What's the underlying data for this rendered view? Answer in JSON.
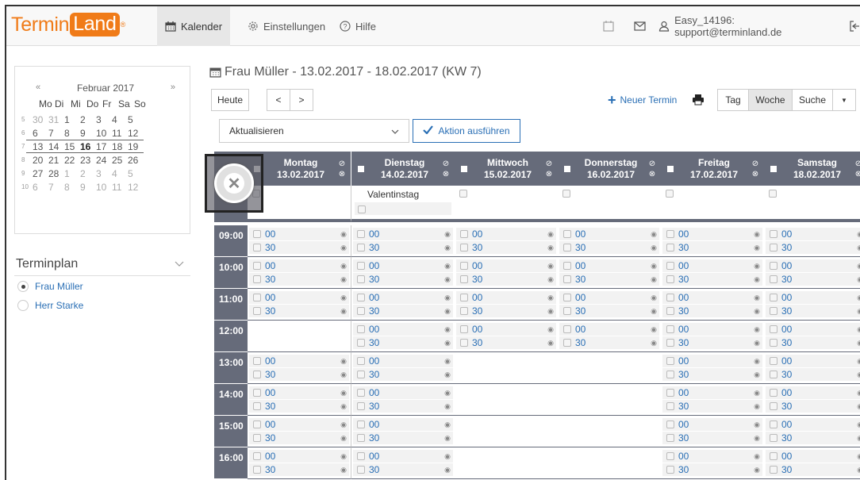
{
  "nav": {
    "logo_a": "Termin",
    "logo_b": "Land",
    "logo_mark": "®",
    "kalender": "Kalender",
    "einstellungen": "Einstellungen",
    "hilfe": "Hilfe",
    "account": "Easy_14196: support@terminland.de"
  },
  "minical": {
    "prev": "«",
    "month": "Februar 2017",
    "next": "»",
    "weekdays": [
      "Mo",
      "Di",
      "Mi",
      "Do",
      "Fr",
      "Sa",
      "So"
    ],
    "rows": [
      {
        "wk": "5",
        "days": [
          "30",
          "31",
          "1",
          "2",
          "3",
          "4",
          "5"
        ]
      },
      {
        "wk": "6",
        "days": [
          "6",
          "7",
          "8",
          "9",
          "10",
          "11",
          "12"
        ]
      },
      {
        "wk": "7",
        "days": [
          "13",
          "14",
          "15",
          "16",
          "17",
          "18",
          "19"
        ]
      },
      {
        "wk": "8",
        "days": [
          "20",
          "21",
          "22",
          "23",
          "24",
          "25",
          "26"
        ]
      },
      {
        "wk": "9",
        "days": [
          "27",
          "28",
          "1",
          "2",
          "3",
          "4",
          "5"
        ]
      },
      {
        "wk": "10",
        "days": [
          "6",
          "7",
          "8",
          "9",
          "10",
          "11",
          "12"
        ]
      }
    ]
  },
  "terminplan": {
    "title": "Terminplan",
    "options": [
      {
        "label": "Frau Müller",
        "selected": true
      },
      {
        "label": "Herr Starke",
        "selected": false
      }
    ]
  },
  "header": {
    "title": "Frau Müller - 13.02.2017 - 18.02.2017 (KW 7)",
    "today": "Heute",
    "prev": "<",
    "next": ">",
    "new_appointment": "Neuer Termin",
    "view_day": "Tag",
    "view_week": "Woche",
    "view_search": "Suche",
    "action_select": "Aktualisieren",
    "action_button": "Aktion ausführen"
  },
  "days": [
    {
      "name": "Montag",
      "date": "13.02.2017",
      "note": ""
    },
    {
      "name": "Dienstag",
      "date": "14.02.2017",
      "note": "Valentinstag"
    },
    {
      "name": "Mittwoch",
      "date": "15.02.2017",
      "note": ""
    },
    {
      "name": "Donnerstag",
      "date": "16.02.2017",
      "note": ""
    },
    {
      "name": "Freitag",
      "date": "17.02.2017",
      "note": ""
    },
    {
      "name": "Samstag",
      "date": "18.02.2017",
      "note": ""
    }
  ],
  "hours": [
    "09:00",
    "10:00",
    "11:00",
    "12:00",
    "13:00",
    "14:00",
    "15:00",
    "16:00"
  ],
  "slot_labels": [
    "00",
    "30"
  ],
  "availability": [
    [
      true,
      true,
      true,
      true,
      true,
      true
    ],
    [
      true,
      true,
      true,
      true,
      true,
      true
    ],
    [
      true,
      true,
      true,
      true,
      true,
      true
    ],
    [
      false,
      true,
      true,
      true,
      true,
      true
    ],
    [
      true,
      true,
      false,
      false,
      true,
      true
    ],
    [
      true,
      true,
      false,
      false,
      true,
      true
    ],
    [
      true,
      true,
      false,
      false,
      true,
      true
    ],
    [
      true,
      true,
      false,
      false,
      true,
      true
    ]
  ]
}
